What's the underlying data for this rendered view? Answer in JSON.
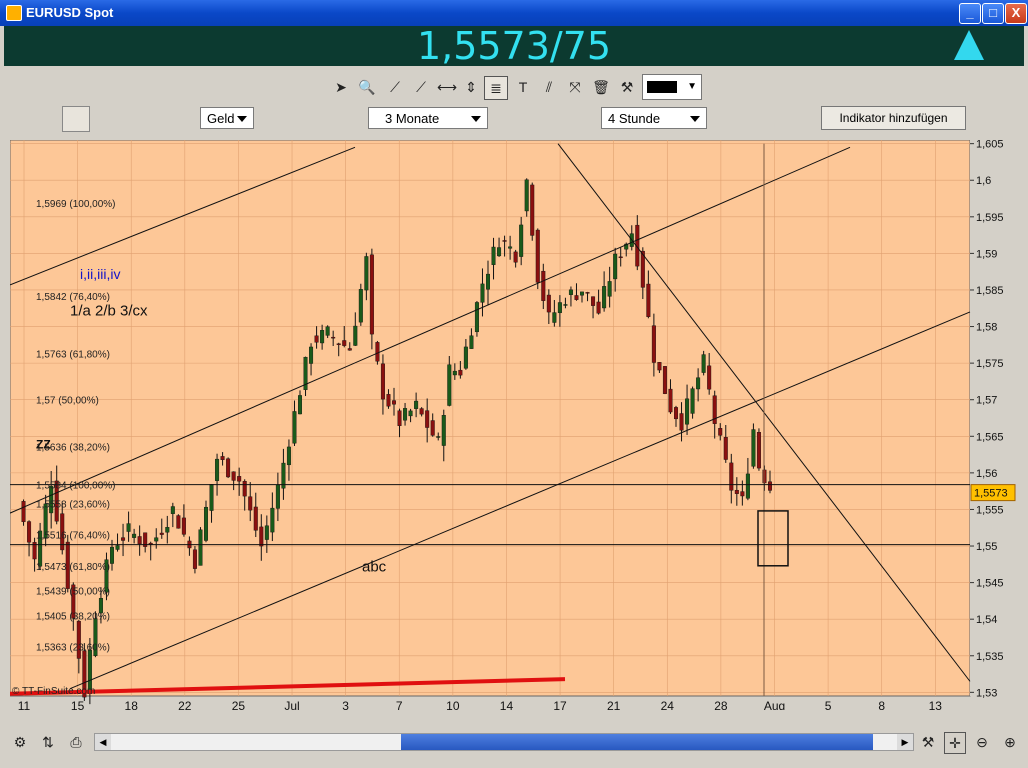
{
  "window": {
    "title": "EURUSD Spot"
  },
  "window_buttons": {
    "minimize": "_",
    "maximize": "□",
    "close": "X"
  },
  "quote": {
    "price": "1,5573/75",
    "direction": "up-arrow-icon",
    "color": "#33e0f0"
  },
  "toolbar": {
    "color_swatch": "#000000",
    "icons": [
      "cursor-icon",
      "zoom-icon",
      "line-icon",
      "line-icon",
      "horizontal-line-icon",
      "vertical-line-icon",
      "fibonacci-icon",
      "text-icon",
      "parallel-icon",
      "channel-icon",
      "trash-icon",
      "tools-icon"
    ]
  },
  "controls": {
    "price_type": "Geld",
    "range": "3 Monate",
    "interval": "4 Stunde",
    "add_indicator": "Indikator hinzufügen"
  },
  "chart_data": {
    "type": "candlestick",
    "background": "#fdc797",
    "y_ticks": [
      "1,605",
      "1,6",
      "1,595",
      "1,59",
      "1,585",
      "1,58",
      "1,575",
      "1,57",
      "1,565",
      "1,56",
      "1,555",
      "1,55",
      "1,545",
      "1,54",
      "1,535",
      "1,53"
    ],
    "y_values": [
      1.605,
      1.6,
      1.595,
      1.59,
      1.585,
      1.58,
      1.575,
      1.57,
      1.565,
      1.56,
      1.555,
      1.55,
      1.545,
      1.54,
      1.535,
      1.53
    ],
    "ylim": [
      1.5295,
      1.6055
    ],
    "x_ticks": [
      "11",
      "15",
      "18",
      "22",
      "25",
      "Jul",
      "3",
      "7",
      "10",
      "14",
      "17",
      "21",
      "24",
      "28",
      "Aug",
      "5",
      "8",
      "13"
    ],
    "last_price_label": "1,5573",
    "last_price": 1.5573,
    "close_path": [
      [
        0,
        1.556
      ],
      [
        3,
        1.548
      ],
      [
        6,
        1.559
      ],
      [
        9,
        1.545
      ],
      [
        12,
        1.53
      ],
      [
        14,
        1.541
      ],
      [
        17,
        1.55
      ],
      [
        20,
        1.552
      ],
      [
        24,
        1.55
      ],
      [
        28,
        1.555
      ],
      [
        32,
        1.548
      ],
      [
        36,
        1.562
      ],
      [
        40,
        1.559
      ],
      [
        44,
        1.55
      ],
      [
        47,
        1.558
      ],
      [
        50,
        1.568
      ],
      [
        53,
        1.578
      ],
      [
        56,
        1.579
      ],
      [
        60,
        1.577
      ],
      [
        63,
        1.589
      ],
      [
        64,
        1.578
      ],
      [
        66,
        1.571
      ],
      [
        69,
        1.567
      ],
      [
        72,
        1.569
      ],
      [
        76,
        1.564
      ],
      [
        78,
        1.574
      ],
      [
        80,
        1.574
      ],
      [
        84,
        1.586
      ],
      [
        87,
        1.592
      ],
      [
        90,
        1.59
      ],
      [
        92,
        1.6
      ],
      [
        94,
        1.587
      ],
      [
        96,
        1.581
      ],
      [
        99,
        1.584
      ],
      [
        102,
        1.585
      ],
      [
        105,
        1.582
      ],
      [
        108,
        1.589
      ],
      [
        111,
        1.593
      ],
      [
        113,
        1.586
      ],
      [
        115,
        1.576
      ],
      [
        118,
        1.569
      ],
      [
        120,
        1.567
      ],
      [
        124,
        1.575
      ],
      [
        126,
        1.567
      ],
      [
        129,
        1.558
      ],
      [
        131,
        1.556
      ],
      [
        133,
        1.566
      ],
      [
        134,
        1.561
      ],
      [
        136,
        1.558
      ]
    ],
    "fib_labels": [
      {
        "text": "1,5969 (100,00%)",
        "y": 1.5969
      },
      {
        "text": "1,5842 (76,40%)",
        "y": 1.5842
      },
      {
        "text": "1,5763 (61,80%)",
        "y": 1.5763
      },
      {
        "text": "1,57 (50,00%)",
        "y": 1.57
      },
      {
        "text": "1,5636 (38,20%)",
        "y": 1.5636
      },
      {
        "text": "1,5584 (100,00%)",
        "y": 1.5584
      },
      {
        "text": "1,5558 (23,60%)",
        "y": 1.5558
      },
      {
        "text": "1,5516 (76,40%)",
        "y": 1.5516
      },
      {
        "text": "1,5473 (61,80%)",
        "y": 1.5473
      },
      {
        "text": "1,5439 (50,00%)",
        "y": 1.5439
      },
      {
        "text": "1,5405 (38,20%)",
        "y": 1.5405
      },
      {
        "text": "1,5363 (23,60%)",
        "y": 1.5363
      }
    ],
    "annotations": {
      "wave_roman": "i,ii,iii,iv",
      "wave_count": "1/a 2/b  3/cx",
      "abc": "abc",
      "zz": "ZZ",
      "copyright": "© TT-FinSuite.com"
    },
    "horizontal_lines": [
      1.5584,
      1.5502
    ],
    "grid": true
  },
  "bottom": {
    "icons": [
      "chart-settings-icon",
      "indicator-icon",
      "print-icon",
      "crosshair-icon",
      "zoom-fit-icon",
      "zoom-out-icon",
      "zoom-in-icon"
    ]
  }
}
